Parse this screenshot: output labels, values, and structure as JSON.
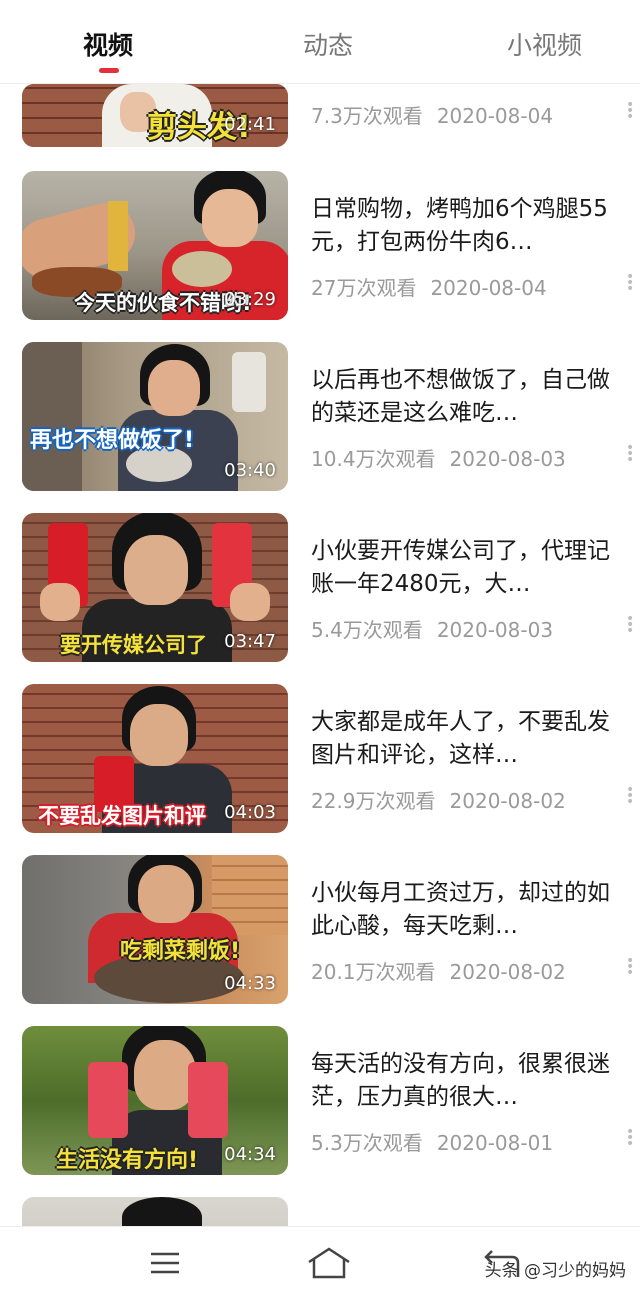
{
  "tabs": [
    {
      "label": "视频",
      "active": true
    },
    {
      "label": "动态",
      "active": false
    },
    {
      "label": "小视频",
      "active": false
    }
  ],
  "videos": [
    {
      "title": "",
      "views": "7.3万次观看",
      "date": "2020-08-04",
      "caption": "剪头发!",
      "duration": "02:41"
    },
    {
      "title": "日常购物，烤鸭加6个鸡腿55元，打包两份牛肉6…",
      "views": "27万次观看",
      "date": "2020-08-04",
      "caption": "今天的伙食不错哟!",
      "duration": "03:29"
    },
    {
      "title": "以后再也不想做饭了，自己做的菜还是这么难吃…",
      "views": "10.4万次观看",
      "date": "2020-08-03",
      "caption": "再也不想做饭了!",
      "duration": "03:40"
    },
    {
      "title": "小伙要开传媒公司了，代理记账一年2480元，大…",
      "views": "5.4万次观看",
      "date": "2020-08-03",
      "caption": "要开传媒公司了",
      "duration": "03:47"
    },
    {
      "title": "大家都是成年人了，不要乱发图片和评论，这样…",
      "views": "22.9万次观看",
      "date": "2020-08-02",
      "caption": "不要乱发图片和评",
      "duration": "04:03"
    },
    {
      "title": "小伙每月工资过万，却过的如此心酸，每天吃剩…",
      "views": "20.1万次观看",
      "date": "2020-08-02",
      "caption": "吃剩菜剩饭!",
      "duration": "04:33"
    },
    {
      "title": "每天活的没有方向，很累很迷茫，压力真的很大…",
      "views": "5.3万次观看",
      "date": "2020-08-01",
      "caption": "生活没有方向!",
      "duration": "04:34"
    }
  ],
  "partial_next_title": "",
  "bottom_nav": {
    "menu_icon": "menu-icon",
    "home_icon": "home-icon",
    "back_icon": "back-icon"
  },
  "watermark": "头条 @习少的妈妈",
  "colors": {
    "accent": "#e4303a",
    "caption_yellow": "#f4e23a",
    "caption_white": "#ffffff"
  }
}
